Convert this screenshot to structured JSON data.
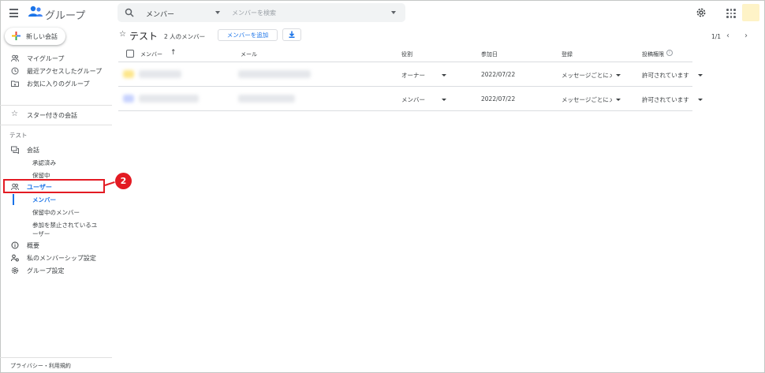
{
  "header": {
    "app_title": "グループ",
    "search_scope": "メンバー",
    "search_placeholder": "メンバーを検索"
  },
  "sidebar": {
    "new_conversation": "新しい会話",
    "top_items": [
      {
        "label": "マイグループ",
        "icon": "people-icon"
      },
      {
        "label": "最近アクセスしたグループ",
        "icon": "history-icon"
      },
      {
        "label": "お気に入りのグループ",
        "icon": "folder-star-icon"
      }
    ],
    "starred": "スター付きの会話",
    "section_title": "テスト",
    "conversations": "会話",
    "conversation_subitems": [
      "承認済み",
      "保留中"
    ],
    "users": "ユーザー",
    "user_subitems": [
      "メンバー",
      "保留中のメンバー",
      "参加を禁止されているユ",
      "ーザー"
    ],
    "about": "概要",
    "membership_settings": "私のメンバーシップ設定",
    "group_settings": "グループ設定",
    "footer": "プライバシー・利用規約",
    "callout_number": "2"
  },
  "main": {
    "group_name": "テスト",
    "member_count": "2 人のメンバー",
    "add_member": "メンバーを追加",
    "pagination": "1/1",
    "columns": {
      "member": "メンバー",
      "email": "メール",
      "role": "役割",
      "joined": "参加日",
      "subscription": "登録",
      "posting": "投稿権限"
    },
    "rows": [
      {
        "role": "オーナー",
        "joined": "2022/07/22",
        "subscription": "メッセージごとにメ",
        "posting": "許可されています",
        "avatar_color": "#fde68a"
      },
      {
        "role": "メンバー",
        "joined": "2022/07/22",
        "subscription": "メッセージごとにメ",
        "posting": "許可されています",
        "avatar_color": "#c7d2fe"
      }
    ]
  },
  "colors": {
    "accent": "#1a73e8",
    "highlight": "#e31b23"
  }
}
